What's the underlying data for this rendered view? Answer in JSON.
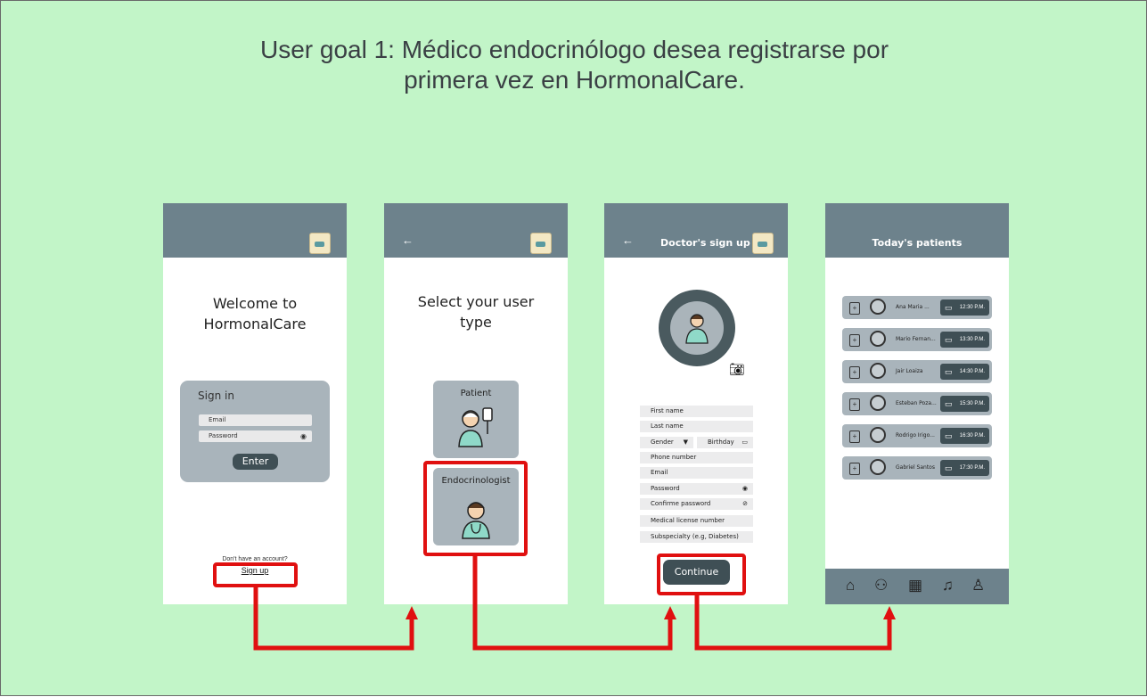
{
  "goal": {
    "line1": "User goal 1: Médico endocrinólogo desea registrarse por",
    "line2": "primera vez en HormonalCare."
  },
  "screen1": {
    "welcome_line1": "Welcome to",
    "welcome_line2": "HormonalCare",
    "signin_label": "Sign in",
    "email_placeholder": "Email",
    "password_placeholder": "Password",
    "enter_label": "Enter",
    "no_account": "Don't have an account?",
    "signup_label": "Sign up"
  },
  "screen2": {
    "back": "←",
    "title_line1": "Select your user",
    "title_line2": "type",
    "patient_label": "Patient",
    "endo_label": "Endocrinologist"
  },
  "screen3": {
    "back": "←",
    "title": "Doctor's sign up",
    "fields": {
      "first_name": "First name",
      "last_name": "Last name",
      "gender": "Gender",
      "birthday": "Birthday",
      "phone": "Phone number",
      "email": "Email",
      "password": "Password",
      "confirm": "Confirme password",
      "license": "Medical license number",
      "subspecialty": "Subspecialty (e.g, Diabetes)"
    },
    "continue_label": "Continue"
  },
  "screen4": {
    "title": "Today's patients",
    "patients": [
      {
        "name": "Ana Maria ...",
        "time": "12:30 P.M."
      },
      {
        "name": "Mario Fernan...",
        "time": "13:30 P.M."
      },
      {
        "name": "Jair Loaiza",
        "time": "14:30 P.M."
      },
      {
        "name": "Esteban Poza...",
        "time": "15:30 P.M."
      },
      {
        "name": "Rodrigo Irigo...",
        "time": "16:30 P.M."
      },
      {
        "name": "Gabriel Santos",
        "time": "17:30 P.M."
      }
    ],
    "nav_icons": [
      "home-icon",
      "patients-icon",
      "calendar-icon",
      "bell-icon",
      "profile-icon"
    ]
  },
  "colors": {
    "background": "#c2f5c8",
    "topbar": "#6d828c",
    "card": "#a9b4bb",
    "button": "#3f4f55",
    "highlight": "#e01010"
  }
}
